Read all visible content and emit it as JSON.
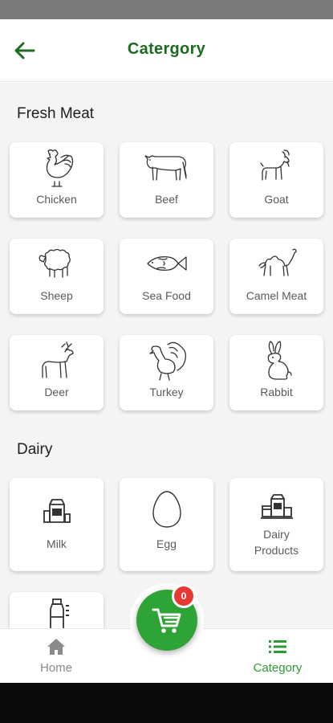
{
  "header": {
    "title": "Catergory",
    "back_icon": "arrow-left-icon",
    "accent": "#1c6b1f"
  },
  "fresh_meat": {
    "title": "Fresh Meat",
    "items": [
      {
        "label": "Chicken",
        "icon": "chicken-icon"
      },
      {
        "label": "Beef",
        "icon": "cow-icon"
      },
      {
        "label": "Goat",
        "icon": "goat-icon"
      },
      {
        "label": "Sheep",
        "icon": "sheep-icon"
      },
      {
        "label": "Sea Food",
        "icon": "fish-icon"
      },
      {
        "label": "Camel Meat",
        "icon": "camel-icon"
      },
      {
        "label": "Deer",
        "icon": "deer-icon"
      },
      {
        "label": "Turkey",
        "icon": "turkey-icon"
      },
      {
        "label": "Rabbit",
        "icon": "rabbit-icon"
      }
    ]
  },
  "dairy": {
    "title": "Dairy",
    "items": [
      {
        "label": "Milk",
        "icon": "milk-icon"
      },
      {
        "label": "Egg",
        "icon": "egg-icon"
      },
      {
        "label": "Dairy\nProducts",
        "icon": "dairy-products-icon"
      },
      {
        "label": "",
        "icon": "milk-bottle-icon"
      }
    ]
  },
  "cart": {
    "count": "0",
    "icon": "cart-icon",
    "color": "#2ea336",
    "badge_color": "#e53935"
  },
  "bottom_nav": {
    "home": {
      "label": "Home",
      "icon": "home-icon"
    },
    "category": {
      "label": "Category",
      "icon": "list-icon",
      "active_color": "#2e9a33"
    }
  }
}
